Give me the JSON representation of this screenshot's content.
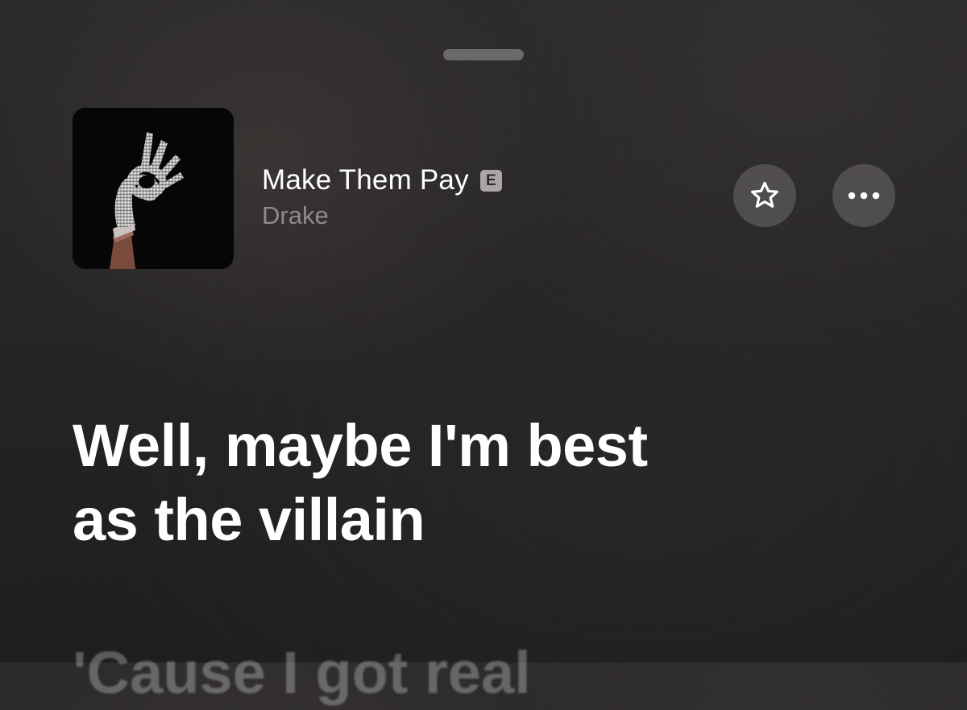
{
  "track": {
    "title": "Make Them Pay",
    "explicit_badge": "E",
    "artist": "Drake"
  },
  "icons": {
    "favorite": "star-icon",
    "more": "ellipsis-icon"
  },
  "lyrics": {
    "current_line_1": "Well, maybe I'm best",
    "current_line_2": "as the villain",
    "next_line_partial": "'Cause I got real"
  },
  "colors": {
    "background": "#272525",
    "button_fill": "#6e6a69",
    "secondary_text": "#8e8b8a",
    "badge": "#a9a6a5"
  }
}
